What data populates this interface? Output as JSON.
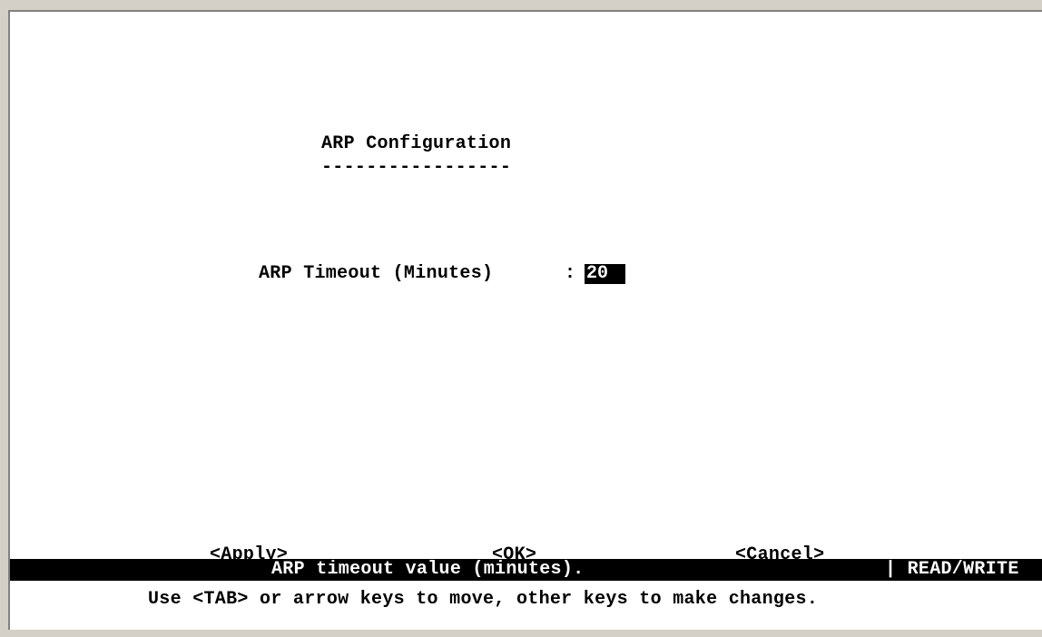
{
  "screen": {
    "title": "ARP Configuration",
    "title_rule": "-----------------"
  },
  "form": {
    "arp_timeout_label": "ARP Timeout (Minutes)",
    "separator": ":",
    "arp_timeout_value": "20"
  },
  "buttons": {
    "apply": "<Apply>",
    "ok": "<OK>",
    "cancel": "<Cancel>"
  },
  "status": {
    "message": "ARP timeout value (minutes).",
    "mode": "| READ/WRITE"
  },
  "help": {
    "text": "Use <TAB> or arrow keys to move, other keys to make changes."
  },
  "colors": {
    "background": "#ffffff",
    "foreground": "#000000",
    "highlight_background": "#000000",
    "highlight_foreground": "#ffffff",
    "window_chrome": "#d4d0c8"
  }
}
